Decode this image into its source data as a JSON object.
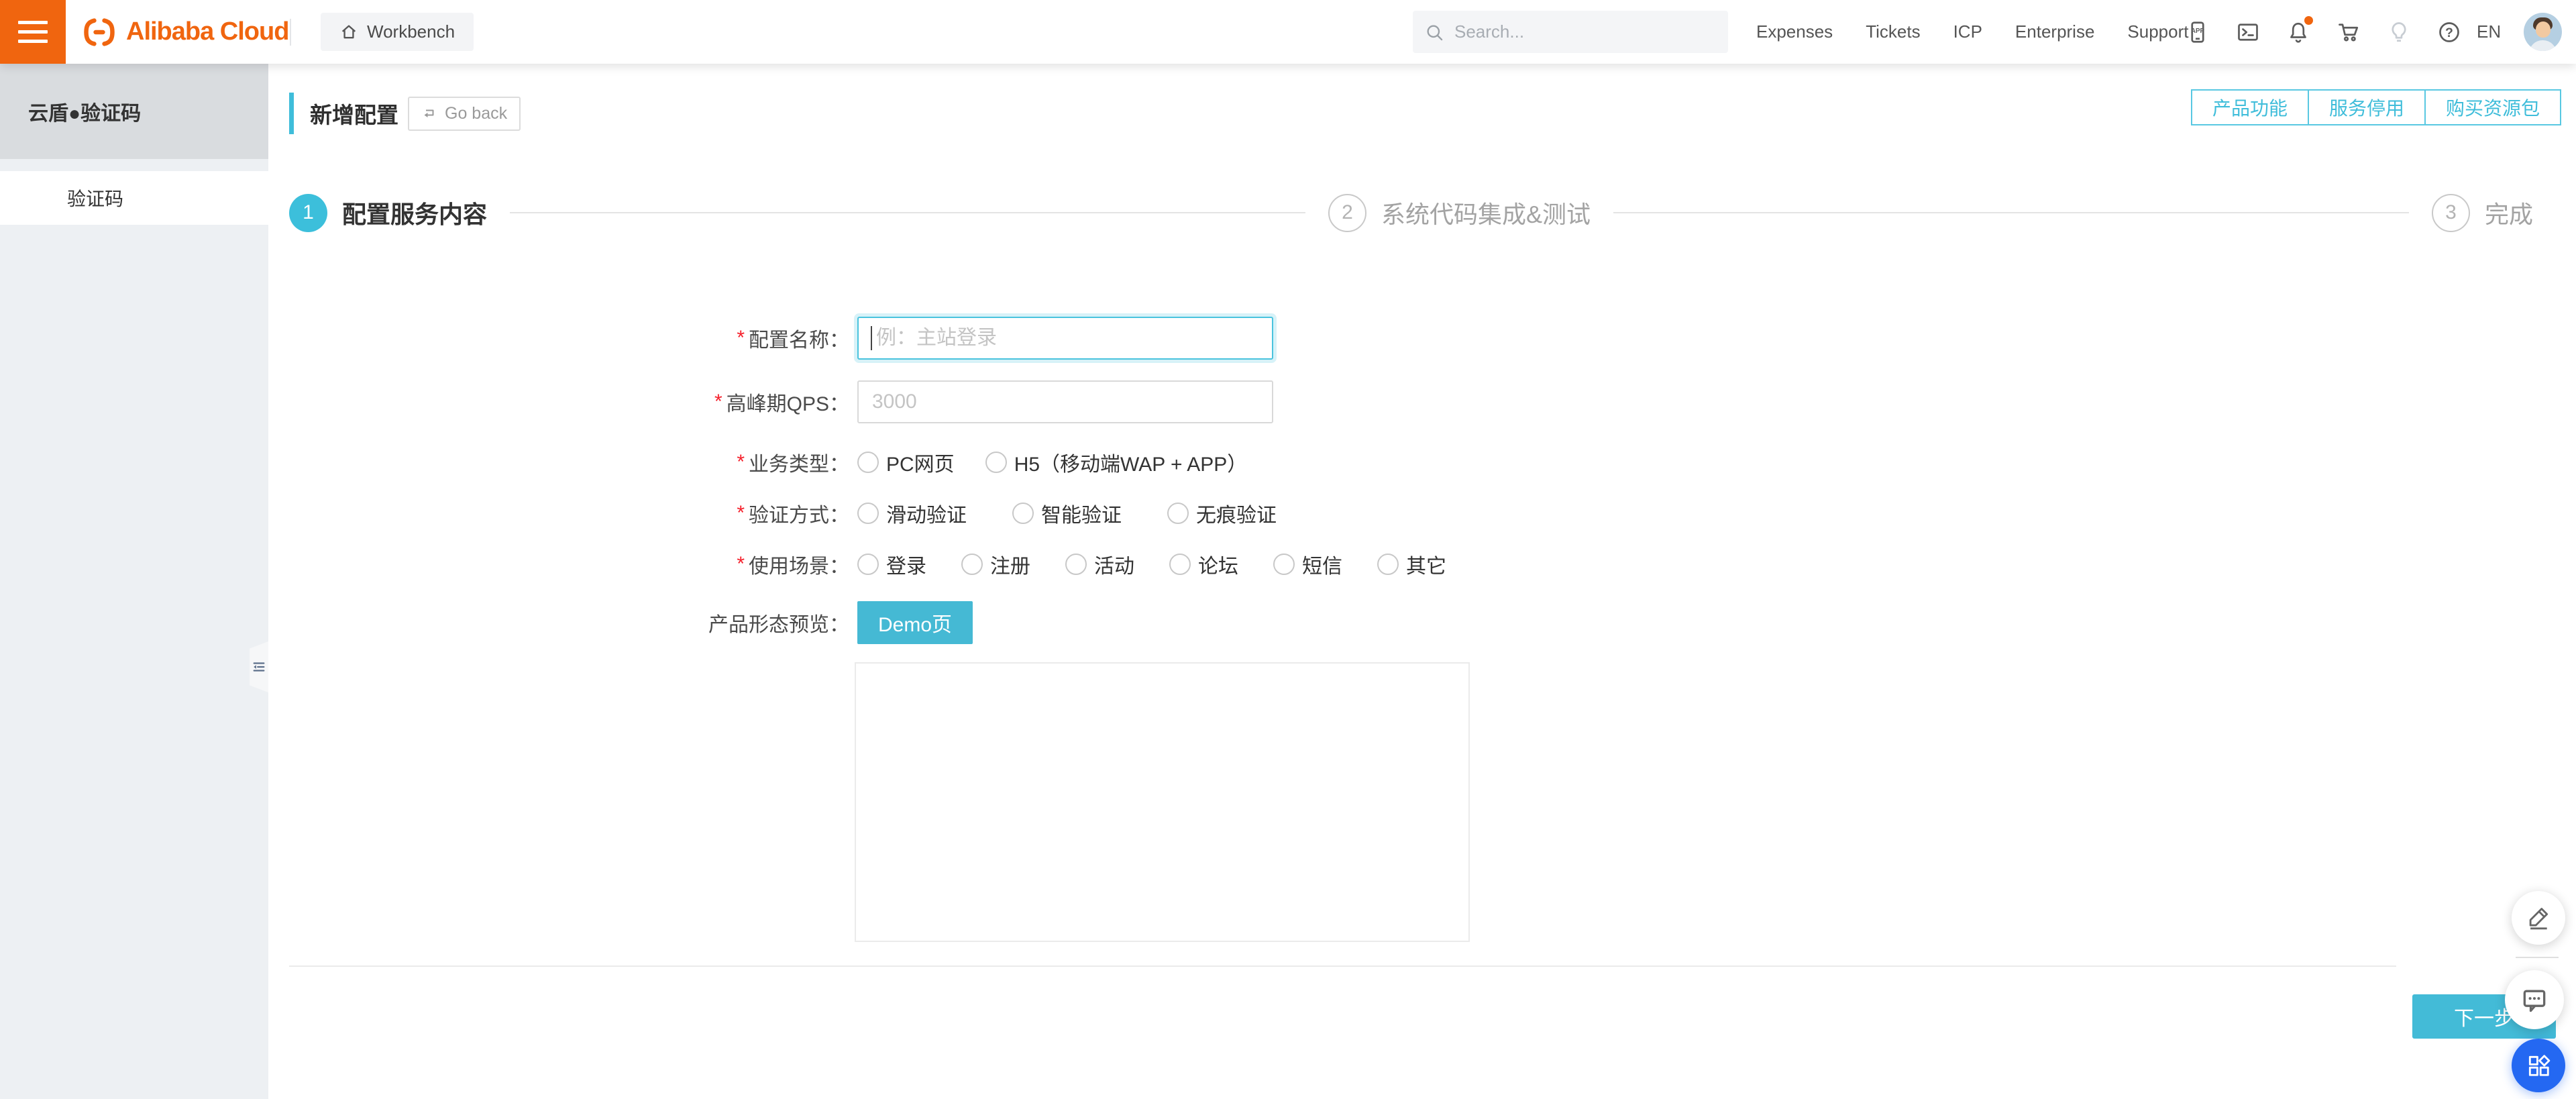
{
  "topnav": {
    "logo_text": "Alibaba Cloud",
    "workbench_label": "Workbench",
    "search_placeholder": "Search...",
    "menu": [
      "Expenses",
      "Tickets",
      "ICP",
      "Enterprise",
      "Support"
    ],
    "locale": "EN",
    "bell_has_notification": true
  },
  "icons": {
    "hamburger": "menu-bars",
    "home": "house",
    "search": "magnifier",
    "mobile_app": "phone-app",
    "console": "terminal",
    "bell": "notification-bell",
    "cart": "shopping-cart",
    "bulb": "lightbulb",
    "help": "question-circle",
    "goback": "return-arrow",
    "pencil": "feedback-pencil",
    "chat": "support-chat",
    "widgets": "app-widgets",
    "collapse": "collapse-menu"
  },
  "sidebar": {
    "title": "云盾●验证码",
    "items": [
      {
        "label": "验证码",
        "active": true
      }
    ]
  },
  "page": {
    "title": "新增配置",
    "go_back_label": "Go back",
    "actions": [
      "产品功能",
      "服务停用",
      "购买资源包"
    ],
    "steps": [
      {
        "num": "1",
        "label": "配置服务内容",
        "active": true
      },
      {
        "num": "2",
        "label": "系统代码集成&测试",
        "active": false
      },
      {
        "num": "3",
        "label": "完成",
        "active": false
      }
    ],
    "required_mark": "*",
    "form": {
      "name": {
        "label": "配置名称：",
        "required": true,
        "value": "",
        "placeholder": "例：主站登录"
      },
      "qps": {
        "label": "高峰期QPS：",
        "required": true,
        "value": "",
        "placeholder": "3000"
      },
      "biz_type": {
        "label": "业务类型：",
        "required": true,
        "options": [
          "PC网页",
          "H5（移动端WAP + APP）"
        ],
        "selected": null
      },
      "verify_mode": {
        "label": "验证方式：",
        "required": true,
        "options": [
          "滑动验证",
          "智能验证",
          "无痕验证"
        ],
        "selected": null
      },
      "scene": {
        "label": "使用场景：",
        "required": true,
        "options": [
          "登录",
          "注册",
          "活动",
          "论坛",
          "短信",
          "其它"
        ],
        "selected": null
      },
      "preview": {
        "label": "产品形态预览：",
        "button_label": "Demo页"
      }
    },
    "next_button": "下一步"
  },
  "colors": {
    "accent_cyan": "#43BBD7",
    "accent_cyan_border": "#59C8E2",
    "brand_orange": "#F0650F",
    "fab_blue": "#2468F2",
    "required_red": "#F5222D"
  }
}
